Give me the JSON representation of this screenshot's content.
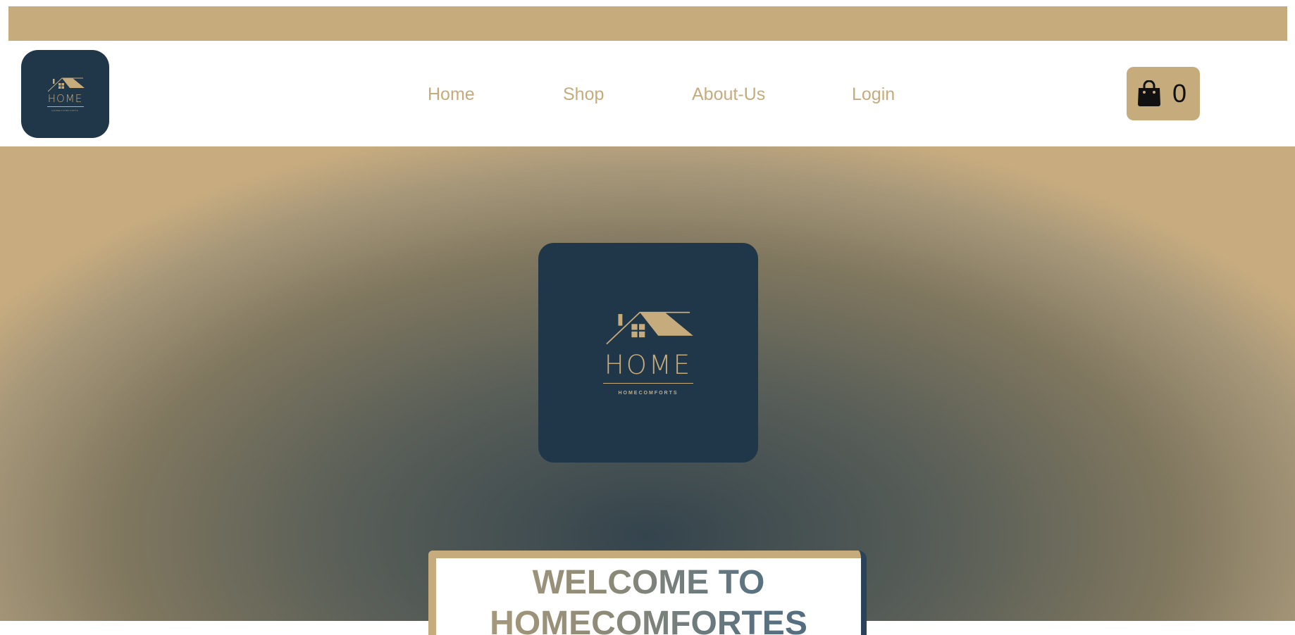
{
  "brand": {
    "word": "HOME",
    "subtitle": "HOMECOMFORTS",
    "logo_bg": "#203649",
    "accent": "#c6ab7d",
    "icon": "house-logo-icon"
  },
  "nav": {
    "items": [
      {
        "label": "Home"
      },
      {
        "label": "Shop"
      },
      {
        "label": "About-Us"
      },
      {
        "label": "Login"
      }
    ]
  },
  "cart": {
    "icon": "shopping-bag-icon",
    "count": "0"
  },
  "hero": {
    "welcome_line1": "WELCOME TO",
    "welcome_line2": "HOMECOMFORTES"
  }
}
